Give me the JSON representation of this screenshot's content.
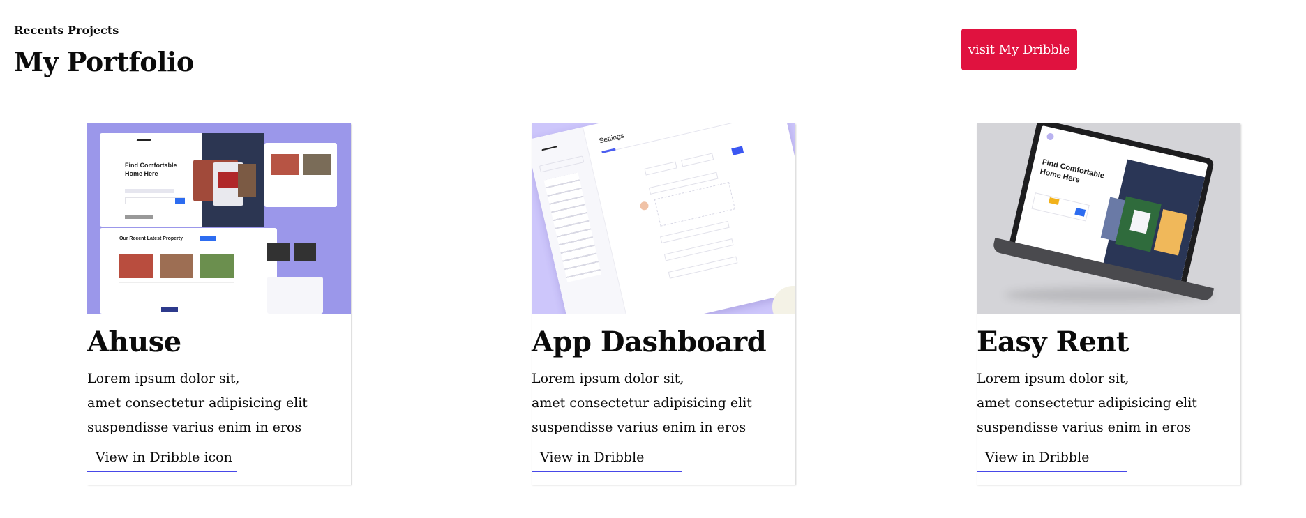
{
  "header": {
    "eyebrow": "Recents Projects",
    "title": "My Portfolio",
    "cta_label": "visit My Dribble"
  },
  "colors": {
    "accent": "#e0123f",
    "link_underline": "#4848e8",
    "thumb_purple": "#9b97ea",
    "thumb_lavender": "#cdc6fb",
    "thumb_gray": "#d4d4d8"
  },
  "projects": [
    {
      "title": "Ahuse",
      "desc": [
        "Lorem ipsum dolor sit,",
        "amet consectetur adipisicing elit",
        "suspendisse varius enim in eros"
      ],
      "link": "View in Dribble icon",
      "thumb": {
        "headline": "Find Comfortable Home Here",
        "section": "Our Recent Latest Property"
      }
    },
    {
      "title": "App Dashboard",
      "desc": [
        "Lorem ipsum dolor sit,",
        "amet consectetur adipisicing elit",
        "suspendisse varius enim in eros"
      ],
      "link": "View in Dribble",
      "thumb": {
        "headline": "Settings"
      }
    },
    {
      "title": "Easy Rent",
      "desc": [
        "Lorem ipsum dolor sit,",
        "amet consectetur adipisicing elit",
        "suspendisse varius enim in eros"
      ],
      "link": "View in Dribble",
      "thumb": {
        "headline": "Find Comfortable Home Here"
      }
    }
  ]
}
